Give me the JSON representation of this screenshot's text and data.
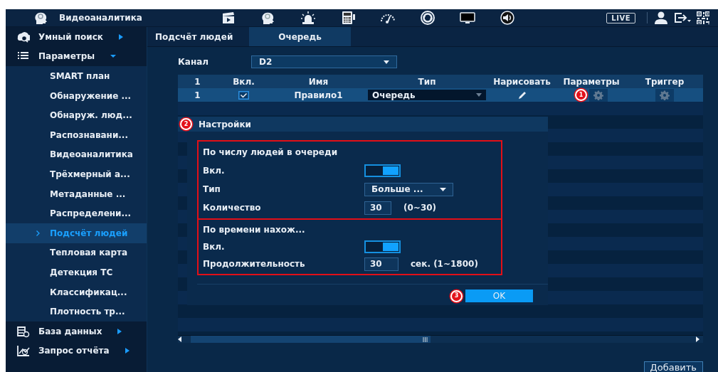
{
  "topbar": {
    "title": "Видеоаналитика",
    "live": "LIVE"
  },
  "sidebar": {
    "items": [
      {
        "label": "Умный поиск",
        "expanded": false
      },
      {
        "label": "Параметры",
        "expanded": true,
        "children": [
          {
            "label": "SMART план",
            "selected": false
          },
          {
            "label": "Обнаружение ...",
            "selected": false
          },
          {
            "label": "Обнаруж. люд...",
            "selected": false
          },
          {
            "label": "Распознавани...",
            "selected": false
          },
          {
            "label": "Видеоаналитика",
            "selected": false
          },
          {
            "label": "Трёхмерный а...",
            "selected": false
          },
          {
            "label": "Метаданные ...",
            "selected": false
          },
          {
            "label": "Распределени...",
            "selected": false
          },
          {
            "label": "Подсчёт людей",
            "selected": true
          },
          {
            "label": "Тепловая карта",
            "selected": false
          },
          {
            "label": "Детекция ТС",
            "selected": false
          },
          {
            "label": "Классификац...",
            "selected": false
          },
          {
            "label": "Плотность тр...",
            "selected": false
          }
        ]
      },
      {
        "label": "База данных",
        "expanded": false
      },
      {
        "label": "Запрос отчёта",
        "expanded": false
      }
    ]
  },
  "tabs": [
    {
      "label": "Подсчёт людей",
      "selected": false
    },
    {
      "label": "Очередь",
      "selected": true
    }
  ],
  "channel": {
    "label": "Канал",
    "value": "D2"
  },
  "table": {
    "columns": [
      "1",
      "Вкл.",
      "Имя",
      "Тип",
      "Нарисовать",
      "Параметры",
      "Триггер"
    ],
    "rows": [
      {
        "number": "1",
        "enabled": true,
        "name": "Правило1",
        "type": "Очередь",
        "selected": true,
        "callout": "1"
      }
    ]
  },
  "dialog": {
    "callout": "2",
    "title": "Настройки",
    "sections": [
      {
        "heading": "По числу людей в очереди",
        "rows": [
          {
            "kind": "toggle",
            "label": "Вкл.",
            "on": true
          },
          {
            "kind": "select",
            "label": "Тип",
            "value": "Больше ..."
          },
          {
            "kind": "number",
            "label": "Количество",
            "value": "30",
            "hint": "(0~30)"
          }
        ]
      },
      {
        "heading": "По времени нахож...",
        "rows": [
          {
            "kind": "toggle",
            "label": "Вкл.",
            "on": true
          },
          {
            "kind": "number",
            "label": "Продолжительность",
            "value": "30",
            "hint": "сек. (1~1800)"
          }
        ]
      }
    ],
    "ok_callout": "3",
    "ok": "OK"
  },
  "add_button": "Добавить"
}
